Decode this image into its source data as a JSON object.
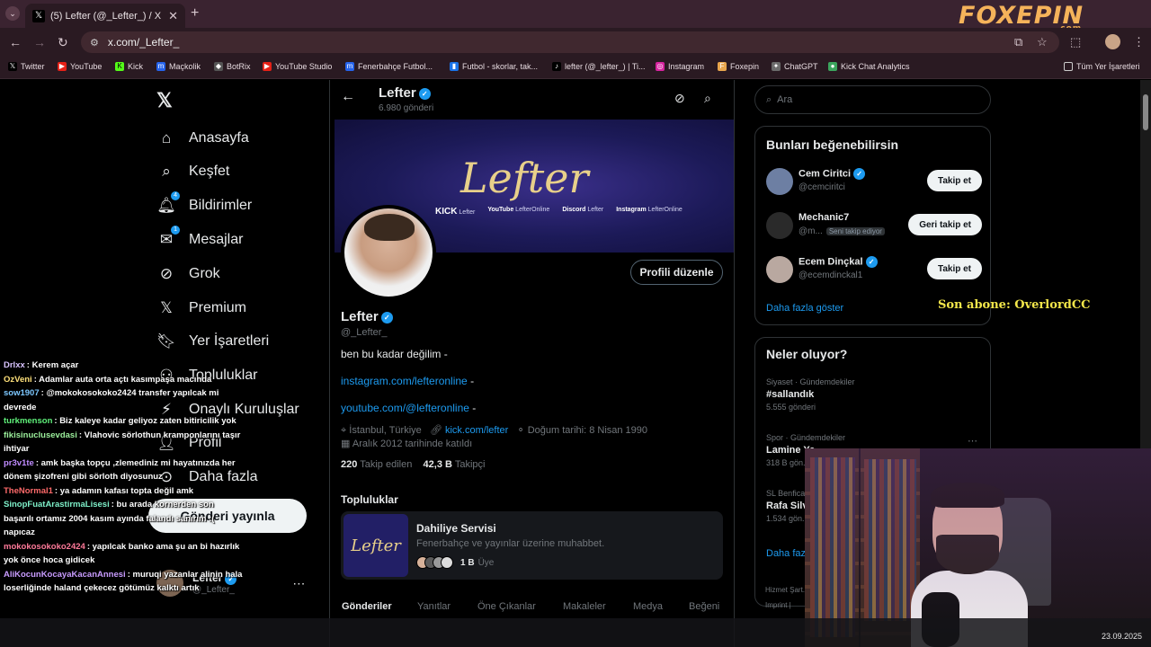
{
  "browser": {
    "tab_title": "(5) Lefter (@_Lefter_) / X",
    "url": "x.com/_Lefter_",
    "brand": "FOXEPIN",
    "brand_sub": ".com",
    "bookmarks": [
      "Twitter",
      "YouTube",
      "Kick",
      "Maçkolik",
      "BotRix",
      "YouTube Studio",
      "Fenerbahçe Futbol...",
      "Futbol - skorlar, tak...",
      "lefter (@_lefter_) | Ti...",
      "Instagram",
      "Foxepin",
      "ChatGPT",
      "Kick Chat Analytics"
    ],
    "bookmarks_all": "Tüm Yer İşaretleri"
  },
  "sidebar": {
    "items": [
      {
        "label": "Anasayfa",
        "icon": "home-icon"
      },
      {
        "label": "Keşfet",
        "icon": "search-icon"
      },
      {
        "label": "Bildirimler",
        "icon": "bell-icon",
        "badge": "4"
      },
      {
        "label": "Mesajlar",
        "icon": "mail-icon",
        "badge": "1"
      },
      {
        "label": "Grok",
        "icon": "grok-icon"
      },
      {
        "label": "Premium",
        "icon": "x-icon"
      },
      {
        "label": "Yer İşaretleri",
        "icon": "bookmark-icon"
      },
      {
        "label": "Topluluklar",
        "icon": "people-icon"
      },
      {
        "label": "Onaylı Kuruluşlar",
        "icon": "lightning-icon"
      },
      {
        "label": "Profil",
        "icon": "person-icon"
      },
      {
        "label": "Daha fazla",
        "icon": "more-circle-icon"
      }
    ],
    "post_button": "Gönderi yayınla",
    "account_name": "Lefter",
    "account_handle": "@_Lefter_"
  },
  "profile": {
    "header_name": "Lefter",
    "post_count": "6.980 gönderi",
    "banner_text": "Lefter",
    "banner_links": [
      {
        "k": "KICK",
        "v": "Lefter"
      },
      {
        "k": "YouTube",
        "v": "LefterOnline"
      },
      {
        "k": "Discord",
        "v": "Lefter"
      },
      {
        "k": "Instagram",
        "v": "LefterOnline"
      }
    ],
    "edit_button": "Profili düzenle",
    "name": "Lefter",
    "handle": "@_Lefter_",
    "bio": "ben bu kadar değilim -",
    "link1": "instagram.com/lefteronline",
    "link2": "youtube.com/@lefteronline",
    "link_suffix": " -",
    "location": "İstanbul, Türkiye",
    "website": "kick.com/lefter",
    "birthday": "Doğum tarihi: 8 Nisan 1990",
    "joined": "Aralık 2012 tarihinde katıldı",
    "following_count": "220",
    "following_label": "Takip edilen",
    "followers_count": "42,3 B",
    "followers_label": "Takipçi",
    "communities_heading": "Topluluklar",
    "community": {
      "title": "Dahiliye Servisi",
      "desc": "Fenerbahçe ve yayınlar üzerine muhabbet.",
      "members": "1 B",
      "members_label": "Üye"
    },
    "tabs": [
      "Gönderiler",
      "Yanıtlar",
      "Öne Çıkanlar",
      "Makaleler",
      "Medya",
      "Beğeni"
    ]
  },
  "right": {
    "search_placeholder": "Ara",
    "suggest_title": "Bunları beğenebilirsin",
    "suggestions": [
      {
        "name": "Cem Ciritci",
        "handle": "@cemciritci",
        "button": "Takip et",
        "note": ""
      },
      {
        "name": "Mechanic7",
        "handle": "@m...",
        "button": "Geri takip et",
        "note": "Seni takip ediyor"
      },
      {
        "name": "Ecem Dinçkal",
        "handle": "@ecemdinckal1",
        "button": "Takip et",
        "note": ""
      }
    ],
    "show_more": "Daha fazla göster",
    "trends_title": "Neler oluyor?",
    "trends": [
      {
        "cat": "Siyaset · Gündemdekiler",
        "title": "#sallandık",
        "posts": "5.555 gönderi"
      },
      {
        "cat": "Spor · Gündemdekiler",
        "title": "Lamine Ya...",
        "posts": "318 B gön..."
      },
      {
        "cat": "SL Benfica...",
        "title": "Rafa Silv...",
        "posts": "1.534 gön..."
      }
    ],
    "trends_more": "Daha faz...",
    "footer1": "Hizmet Şart...",
    "footer2": "Imprint |"
  },
  "overlay": {
    "sub_alert": "Son abone: OverlordCC",
    "chat": [
      {
        "user": "Drlxx",
        "color": "#d9c4ff",
        "msg": "Kerem açar"
      },
      {
        "user": "OzVeni",
        "color": "#ffe17a",
        "msg": "Adamlar auta orta açtı kasımpaşa macında"
      },
      {
        "user": "sow1907",
        "color": "#7cc7ff",
        "msg": "@mokokosokoko2424 transfer yapılcak mi devrede"
      },
      {
        "user": "turkmenson",
        "color": "#5ff07a",
        "msg": "Biz kaleye kadar geliyoz zaten bitiricilik yok"
      },
      {
        "user": "fikisinuclusevdasi",
        "color": "#9cf09c",
        "msg": "Vlahovic sörlothun kramponlarını taşır ihtiyar"
      },
      {
        "user": "pr3v1te",
        "color": "#c08cff",
        "msg": "amk başka topçu ,zlemediniz mi hayatınızda her dönem şizofreni gibi sörloth diyosunuz"
      },
      {
        "user": "TheNormal1",
        "color": "#ff6a6a",
        "msg": "ya adamın kafası topta değil amk"
      },
      {
        "user": "SinopFuatArastirmaLisesi",
        "color": "#7ef0c9",
        "msg": "bu arada kornerden son başarılı ortamız 2004 kasım ayında falandı sanırım :( napıcaz"
      },
      {
        "user": "mokokosokoko2424",
        "color": "#ff7a9a",
        "msg": "yapılcak banko ama şu an bi hazırlık yok önce hoca gidicek"
      },
      {
        "user": "AliKocunKocayaKacanAnnesi",
        "color": "#c99cff",
        "msg": "muruqi yazanlar alinin hala loserliğinde haland çekecez götümüz kalktı artık"
      }
    ],
    "taskbar_date": "23.09.2025"
  }
}
